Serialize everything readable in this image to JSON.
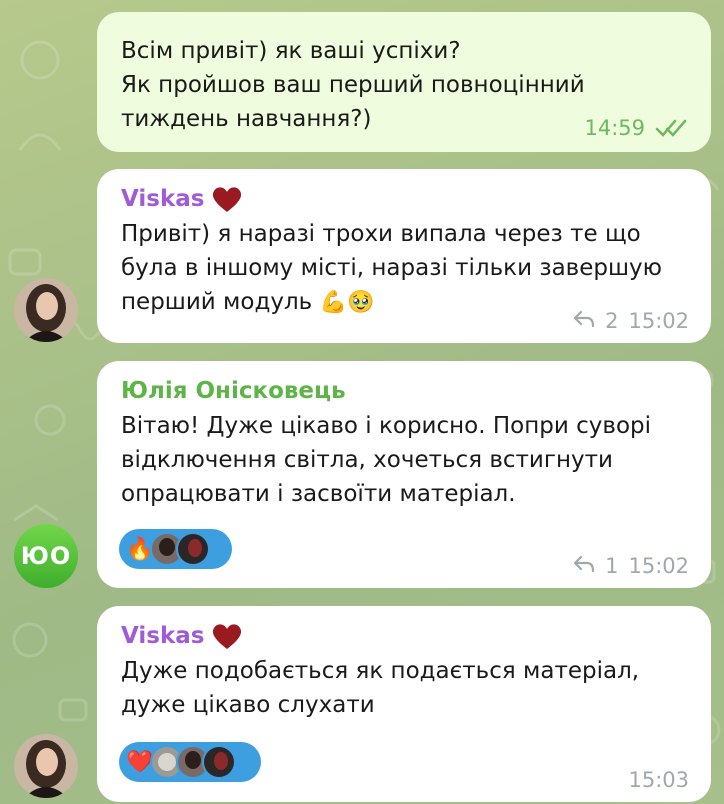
{
  "colors": {
    "outgoing_bubble": "#effdde",
    "incoming_bubble": "#ffffff",
    "sender_purple": "#a05bd6",
    "sender_green": "#5fb448",
    "reaction_pill": "#3d9ee0",
    "meta_grey": "#a0a8ad",
    "meta_green": "#6eb860"
  },
  "messages": [
    {
      "direction": "outgoing",
      "text": "Всім привіт) як ваші успіхи?\nЯк пройшов ваш перший повноцінний\nтиждень навчання?)",
      "time": "14:59",
      "status_icon": "double-check-icon"
    },
    {
      "direction": "incoming",
      "sender": "Viskas",
      "sender_badge": "heart-icon",
      "text": "Привіт) я наразі трохи випала через те що\nбула в іншому місті, наразі тільки завершую\nперший модуль",
      "inline_emoji": "💪🥹",
      "reply_count": "2",
      "time": "15:02",
      "avatar": "photo-avatar"
    },
    {
      "direction": "incoming",
      "sender": "Юлія Онісковець",
      "text": "Вітаю! Дуже цікаво і корисно. Попри суворі\nвідключення світла, хочеться встигнути\nопрацювати і засвоїти матеріал.",
      "reaction_emoji": "🔥",
      "reply_count": "1",
      "time": "15:02",
      "avatar_initials": "ЮО"
    },
    {
      "direction": "incoming",
      "sender": "Viskas",
      "sender_badge": "heart-icon",
      "text": "Дуже подобається як подається матеріал,\nдуже цікаво слухати",
      "reaction_emoji": "❤️",
      "time": "15:03",
      "avatar": "photo-avatar"
    }
  ]
}
